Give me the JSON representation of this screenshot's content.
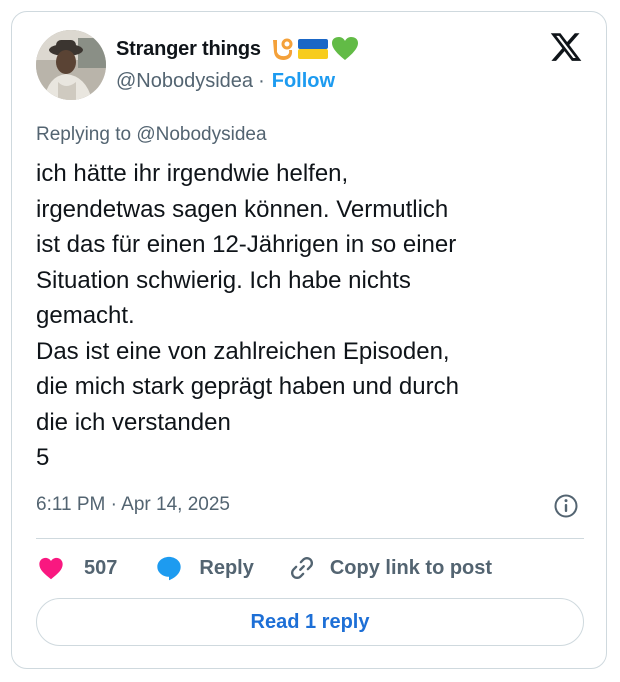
{
  "author": {
    "display_name": "Stranger things",
    "handle": "@Nobodysidea",
    "follow_label": "Follow",
    "separator": "·",
    "emojis": [
      "anchor-emoji",
      "ukraine-flag-emoji",
      "green-heart-emoji"
    ]
  },
  "tweet": {
    "replying_to": "Replying to @Nobodysidea",
    "text": "ich hätte ihr irgendwie helfen,\nirgendetwas sagen können. Vermutlich\nist das für einen 12-Jährigen in so einer\nSituation schwierig. Ich habe nichts\ngemacht.\nDas ist eine von zahlreichen Episoden,\ndie mich stark geprägt haben und durch\ndie ich verstanden\n5",
    "timestamp": "6:11 PM · Apr 14, 2025"
  },
  "actions": {
    "like_count": "507",
    "reply_label": "Reply",
    "copy_link_label": "Copy link to post"
  },
  "read_replies_label": "Read 1 reply",
  "colors": {
    "accent": "#1d9bf0",
    "like": "#f91880",
    "text": "#0f1419",
    "secondary": "#536471",
    "border": "#cfd9de"
  },
  "icons": [
    "x-logo-icon",
    "info-icon",
    "heart-icon",
    "reply-bubble-icon",
    "link-icon"
  ]
}
